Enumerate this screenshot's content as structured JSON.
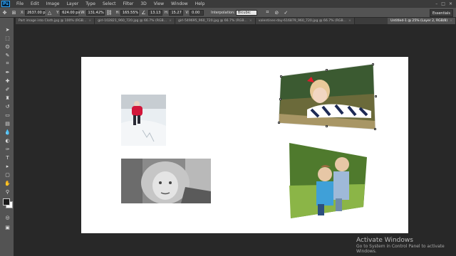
{
  "app": {
    "logo": "Ps"
  },
  "menu": [
    "File",
    "Edit",
    "Image",
    "Layer",
    "Type",
    "Select",
    "Filter",
    "3D",
    "View",
    "Window",
    "Help"
  ],
  "window_controls": [
    "–",
    "□",
    "✕"
  ],
  "options": {
    "x_label": "X:",
    "x_value": "2637.00 p",
    "y_label": "Y:",
    "y_value": "624.00 px",
    "w_label": "W:",
    "w_value": "131.42%",
    "h_label": "H:",
    "h_value": "165.55%",
    "angle_value": "13.13",
    "hskew_label": "H:",
    "hskew_value": "15.27",
    "vskew_label": "V:",
    "vskew_value": "0.00",
    "interp_label": "Interpolation:",
    "interp_value": "Bicubic",
    "workspace": "Essentials"
  },
  "tabs": [
    "Part image into Cloth.jpg @ 100% (RGB...",
    "girl-102821_960_720.jpg @ 66.7% (RGB...",
    "girl-549695_960_720.jpg @ 66.7% (RGB...",
    "valentines-day-616879_960_720.jpg @ 66.7% (RGB...",
    "Untitled-1 @ 25% (Layer 2, RGB/8)"
  ],
  "watermark": {
    "title": "Activate Windows",
    "subtitle": "Go to System in Control Panel to activate",
    "subtitle2": "Windows."
  },
  "colors": {
    "chrome": "#535353",
    "workspace": "#282828",
    "canvas": "#ffffff",
    "accent": "#31a8ff"
  }
}
